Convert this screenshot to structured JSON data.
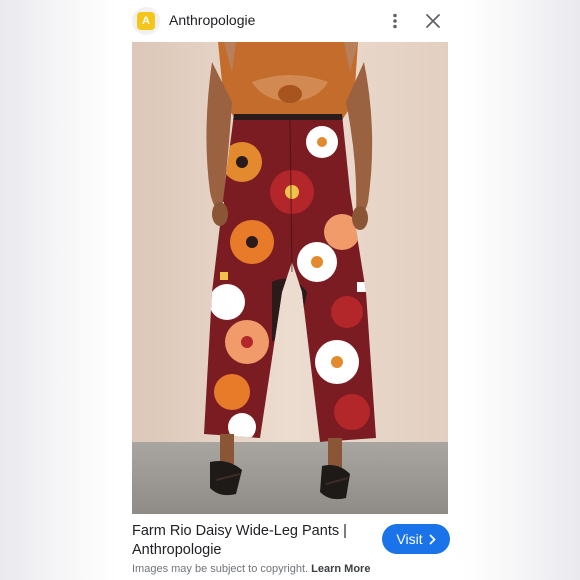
{
  "header": {
    "favicon_letter": "A",
    "site_name": "Anthropologie",
    "more_icon": "more-vertical-icon",
    "close_icon": "close-icon"
  },
  "image": {
    "subject": "model-back-view-floral-wide-leg-pants"
  },
  "result": {
    "title": "Farm Rio Daisy Wide-Leg Pants | Anthropologie",
    "visit_label": "Visit",
    "visit_icon": "chevron-right-icon",
    "copyright_text": "Images may be subject to copyright.",
    "learn_more_label": "Learn More"
  },
  "colors": {
    "accent": "#1a73e8",
    "favicon": "#f4c51b",
    "text_primary": "#202124",
    "text_secondary": "#70757a"
  }
}
